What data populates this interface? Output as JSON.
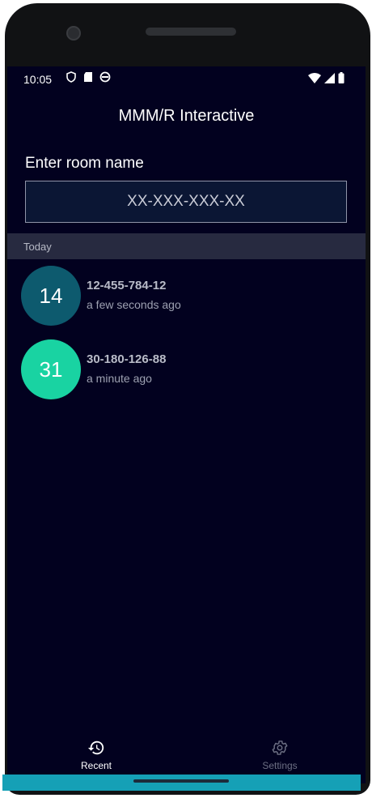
{
  "status_bar": {
    "time": "10:05"
  },
  "app": {
    "title": "MMM/R Interactive"
  },
  "room": {
    "prompt": "Enter room name",
    "placeholder": "XX-XXX-XXX-XX"
  },
  "recent": {
    "section_label": "Today",
    "items": [
      {
        "badge": "14",
        "room": "12-455-784-12",
        "time": "a few seconds ago",
        "color": "#0d5a6e"
      },
      {
        "badge": "31",
        "room": "30-180-126-88",
        "time": "a minute ago",
        "color": "#19d3a2"
      }
    ]
  },
  "nav": {
    "recent_label": "Recent",
    "settings_label": "Settings",
    "active": "recent",
    "active_color": "#ffffff",
    "inactive_color": "#6c6f83"
  },
  "colors": {
    "background": "#02011f",
    "input_bg": "#0b1634",
    "section_bg": "#272a40",
    "home_bar": "#15a0b6"
  }
}
